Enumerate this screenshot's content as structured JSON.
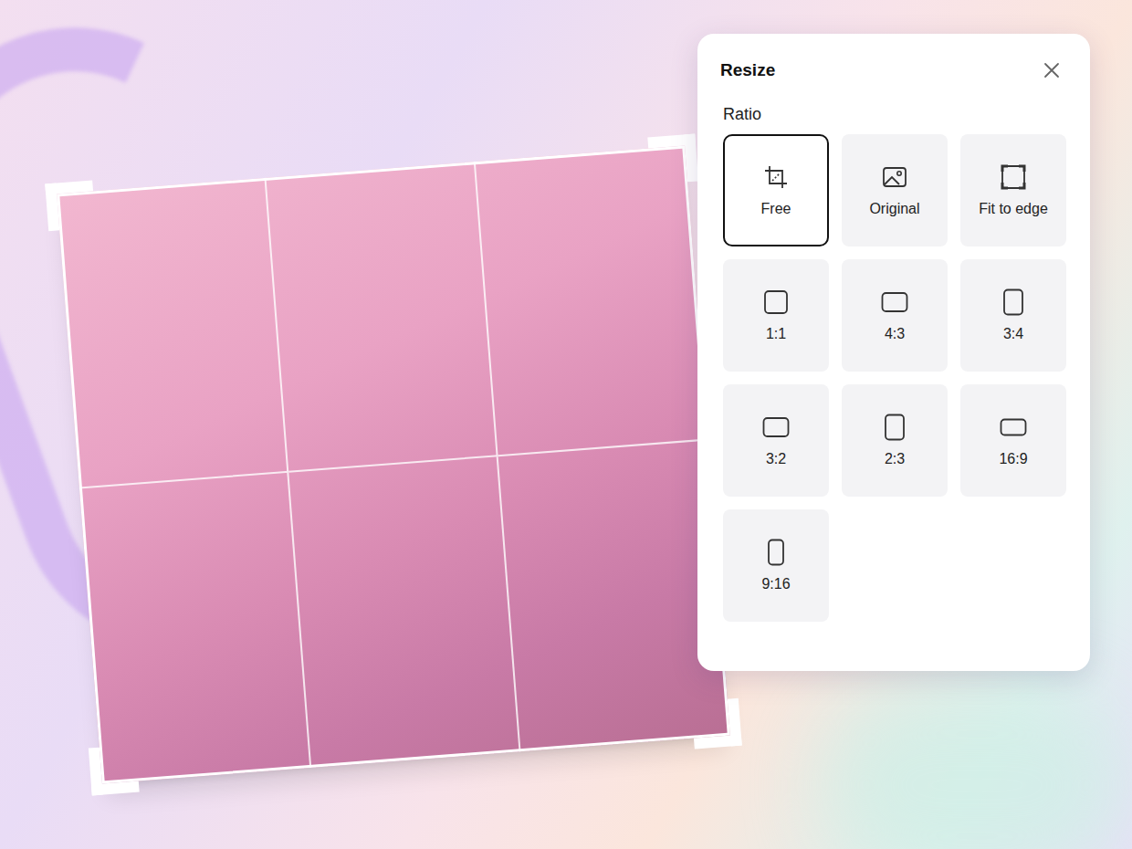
{
  "panel": {
    "title": "Resize",
    "section": "Ratio",
    "options": [
      {
        "label": "Free",
        "kind": "free",
        "selected": true
      },
      {
        "label": "Original",
        "kind": "original",
        "selected": false
      },
      {
        "label": "Fit to edge",
        "kind": "fit",
        "selected": false
      },
      {
        "label": "1:1",
        "kind": "square",
        "selected": false
      },
      {
        "label": "4:3",
        "kind": "landscape",
        "selected": false
      },
      {
        "label": "3:4",
        "kind": "portrait",
        "selected": false
      },
      {
        "label": "3:2",
        "kind": "landscape",
        "selected": false
      },
      {
        "label": "2:3",
        "kind": "portrait",
        "selected": false
      },
      {
        "label": "16:9",
        "kind": "wide",
        "selected": false
      },
      {
        "label": "9:16",
        "kind": "tall",
        "selected": false
      }
    ]
  }
}
